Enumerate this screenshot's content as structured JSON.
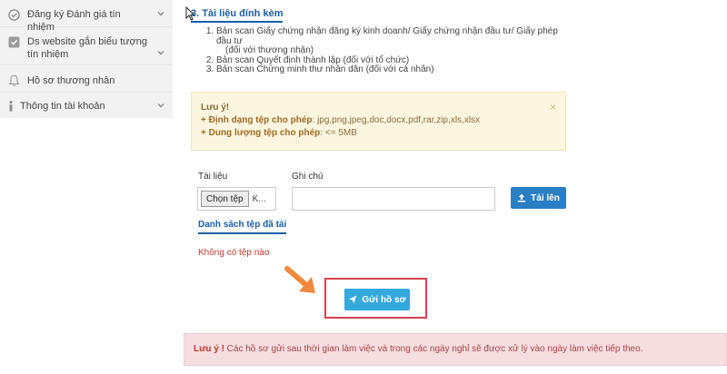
{
  "sidebar": {
    "items": [
      {
        "label": "Đăng ký Đánh giá tín nhiệm",
        "icon": "check-circle-icon"
      },
      {
        "label": "Ds website gắn biểu tượng tín nhiệm",
        "icon": "check-square-icon"
      },
      {
        "label": "Hồ sơ thương nhân",
        "icon": "bell-icon"
      },
      {
        "label": "Thông tin tài khoản",
        "icon": "info-icon"
      }
    ]
  },
  "section": {
    "title": "3. Tài liệu đính kèm",
    "doc_items": [
      {
        "line": "Bản scan Giấy chứng nhận đăng ký kinh doanh/ Giấy chứng nhận đầu tư/ Giấy phép đầu tư",
        "sub": "(đối với thương nhân)"
      },
      {
        "line": "Bản scan Quyết định thành lập (đối với tổ chức)",
        "sub": ""
      },
      {
        "line": "Bản scan Chứng minh thư nhân dân (đối với cá nhân)",
        "sub": ""
      }
    ]
  },
  "notice": {
    "title": "Lưu ý!",
    "format_label": "+ Định dạng tệp cho phép",
    "format_value": ": jpg,png,jpeg,doc,docx,pdf,rar,zip,xls,xlsx",
    "size_label": "+ Dung lượng tệp cho phép",
    "size_value": ": <= 5MB",
    "close": "×"
  },
  "upload": {
    "doc_label": "Tài liệu",
    "note_label": "Ghi chú",
    "choose_button": "Chọn tệp",
    "file_name": "K...",
    "note_value": "",
    "upload_button": "Tải lên"
  },
  "file_list": {
    "title": "Danh sách tệp đã tải",
    "empty_text": "Không có tệp nào"
  },
  "submit": {
    "label": "Gửi hồ sơ"
  },
  "footer_notice": {
    "label": "Lưu ý !",
    "text": " Các hồ sơ gửi sau thời gian làm việc và trong các ngày nghỉ sẽ được xử lý vào ngày làm việc tiếp theo."
  },
  "colors": {
    "link_blue": "#1a5fa8",
    "upload_button": "#2a7fc4",
    "submit_button": "#33a9dd",
    "highlight": "#d9424e",
    "arrow": "#f0883e"
  }
}
